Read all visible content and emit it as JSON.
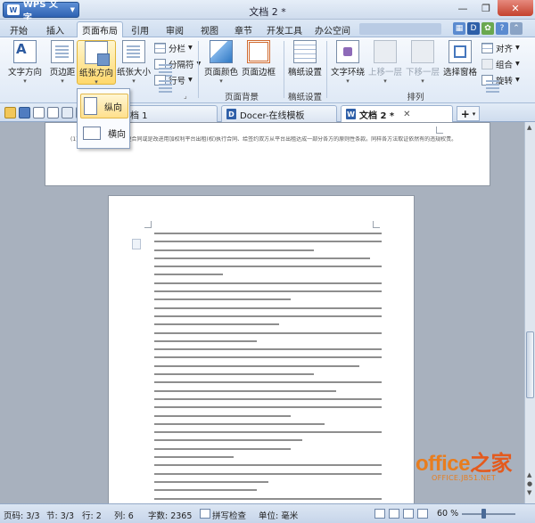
{
  "app": {
    "name": "WPS 文字",
    "logo_text": "W"
  },
  "window": {
    "title": "文档 2 *",
    "minimize": "—",
    "restore": "❐",
    "close": "✕"
  },
  "menu_tabs": [
    "开始",
    "插入",
    "页面布局",
    "引用",
    "审阅",
    "视图",
    "章节",
    "开发工具",
    "办公空间"
  ],
  "active_menu": "页面布局",
  "ribbon": {
    "text_direction": "文字方向",
    "margins": "页边距",
    "orientation": "纸张方向",
    "paper_size": "纸张大小",
    "columns": "分栏",
    "breaks": "分隔符",
    "line_numbers": "行号",
    "page_color": "页面颜色",
    "page_border": "页面边框",
    "page_background_group": "页面背景",
    "manuscript_settings": "稿纸设置",
    "manuscript_group": "稿纸设置",
    "text_wrap": "文字环绕",
    "bring_forward": "上移一层",
    "send_backward": "下移一层",
    "selection_pane": "选择窗格",
    "align": "对齐",
    "group": "组合",
    "rotate": "旋转",
    "arrange_group": "排列"
  },
  "orientation_menu": {
    "portrait": "纵向",
    "landscape": "横向",
    "selected": "纵向"
  },
  "doc_tabs": [
    {
      "label": "档 1",
      "active": false
    },
    {
      "label": "Docer-在线模板",
      "active": false
    },
    {
      "label": "文档 2 *",
      "active": true
    }
  ],
  "add_tab": "+",
  "document": {
    "page1_text": "(1)在双方一方不同意变更合同或是改进用加权利平台出租(权)执行合同、给签约双方从平台出租达成一部分各方的原则性条款。同样各方法取证依然有的违规权责。"
  },
  "status": {
    "page": "页码: 3/3",
    "section": "节: 3/3",
    "line": "行: 2",
    "column": "列: 6",
    "word_count": "字数: 2365",
    "spell_check": "拼写检查",
    "unit": "单位: 毫米",
    "zoom": "60 %",
    "zoom_fraction": 0.4
  },
  "watermark": {
    "main": "office",
    "main_cn": "之家",
    "sub": "OFFICE.JB51.NET"
  },
  "colors": {
    "accent": "#2f62b2",
    "ribbon_bg": "#dfe9f6",
    "workspace_bg": "#a8b1be",
    "watermark": "#e87d1e"
  }
}
